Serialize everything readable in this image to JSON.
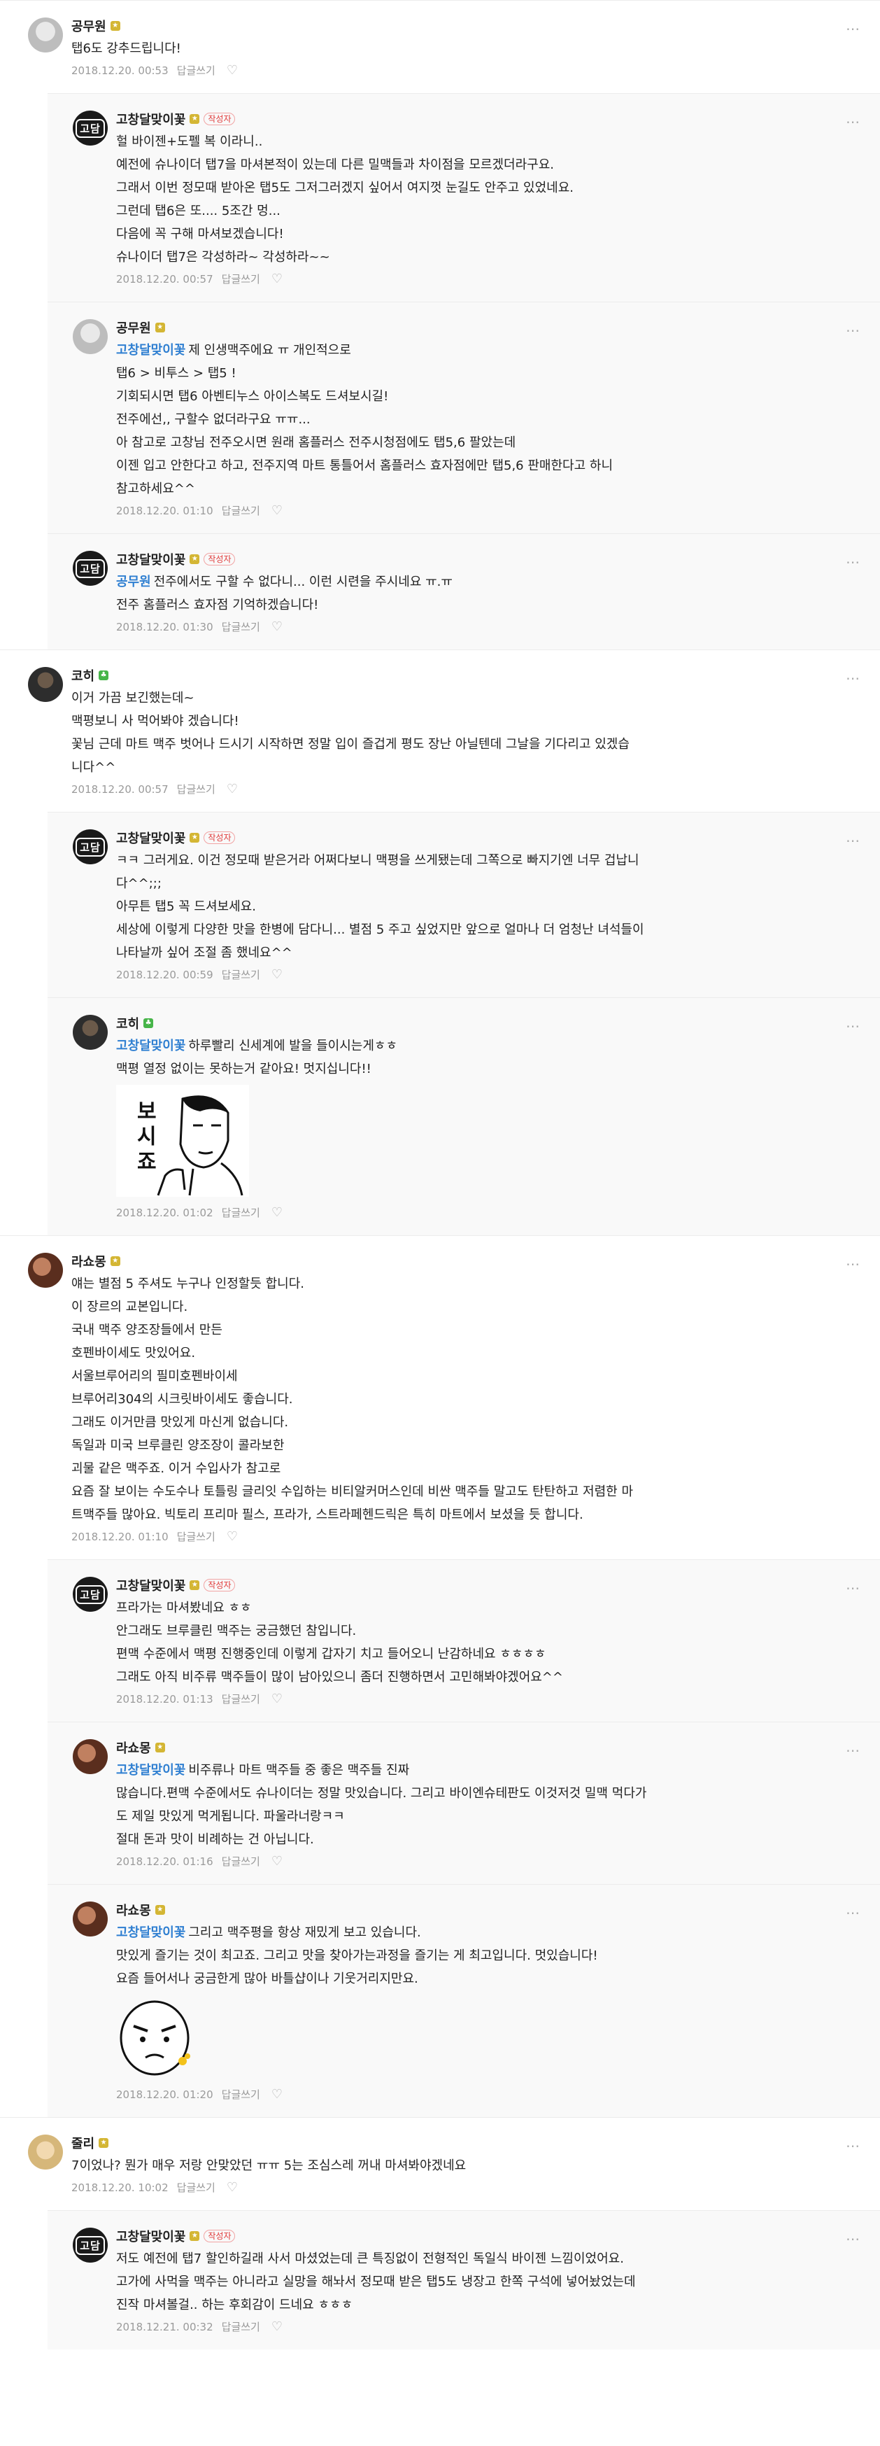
{
  "comments": [
    {
      "id": "c1",
      "reply": false,
      "name": "공무원",
      "avatar": "p1",
      "badge": "gold",
      "author_tag": "",
      "mention": "",
      "text": "탭6도 강추드립니다!",
      "date": "2018.12.20. 00:53",
      "reply_label": "답글쓰기",
      "sticker": ""
    },
    {
      "id": "c2",
      "reply": true,
      "name": "고창달맞이꽃",
      "avatar": "brand",
      "badge": "gold",
      "author_tag": "작성자",
      "mention": "",
      "text": "헐 바이젠+도펠 복 이라니..\n예전에 슈나이더 탭7을 마셔본적이 있는데 다른 밀맥들과 차이점을 모르겠더라구요.\n그래서 이번 정모때 받아온 탭5도 그저그러겠지 싶어서 여지껏 눈길도 안주고 있었네요.\n그런데 탭6은 또.... 5조간 멍...\n다음에 꼭 구해 마셔보겠습니다!\n슈나이더 탭7은 각성하라~ 각성하라~~",
      "date": "2018.12.20. 00:57",
      "reply_label": "답글쓰기",
      "sticker": ""
    },
    {
      "id": "c3",
      "reply": true,
      "name": "공무원",
      "avatar": "p1",
      "badge": "gold",
      "author_tag": "",
      "mention": "고창달맞이꽃",
      "text": "제 인생맥주에요 ㅠ 개인적으로\n탭6 > 비투스 > 탭5 !\n기회되시면 탭6 아벤티누스 아이스복도 드셔보시길!\n전주에선,, 구할수 없더라구요 ㅠㅠ...\n아 참고로 고창님 전주오시면 원래 홈플러스 전주시청점에도 탭5,6 팔았는데\n이젠 입고 안한다고 하고, 전주지역 마트 통틀어서 홈플러스 효자점에만 탭5,6 판매한다고 하니\n참고하세요^^",
      "date": "2018.12.20. 01:10",
      "reply_label": "답글쓰기",
      "sticker": ""
    },
    {
      "id": "c4",
      "reply": true,
      "name": "고창달맞이꽃",
      "avatar": "brand",
      "badge": "gold",
      "author_tag": "작성자",
      "mention": "공무원",
      "text": "전주에서도 구할 수 없다니... 이런 시련을 주시네요 ㅠ.ㅠ\n전주 홈플러스 효자점 기억하겠습니다!",
      "date": "2018.12.20. 01:30",
      "reply_label": "답글쓰기",
      "sticker": ""
    },
    {
      "id": "c5",
      "reply": false,
      "name": "코히",
      "avatar": "p2",
      "badge": "green",
      "author_tag": "",
      "mention": "",
      "text": "이거 가끔 보긴했는데~\n맥평보니 사 먹어봐야 겠습니다!\n꽃님 근데 마트 맥주 벗어나 드시기 시작하면 정말 입이 즐겁게 평도 장난 아닐텐데 그날을 기다리고 있겠습\n니다^^",
      "date": "2018.12.20. 00:57",
      "reply_label": "답글쓰기",
      "sticker": ""
    },
    {
      "id": "c6",
      "reply": true,
      "name": "고창달맞이꽃",
      "avatar": "brand",
      "badge": "gold",
      "author_tag": "작성자",
      "mention": "",
      "text": "ㅋㅋ 그러게요. 이건 정모때 받은거라 어쩌다보니 맥평을 쓰게됐는데 그쪽으로 빠지기엔 너무 겁납니\n다^^;;;\n아무튼 탭5 꼭 드셔보세요.\n세상에 이렇게 다양한 맛을 한병에 담다니... 별점 5 주고 싶었지만 앞으로 얼마나 더 엄청난 녀석들이\n나타날까 싶어 조절 좀 했네요^^",
      "date": "2018.12.20. 00:59",
      "reply_label": "답글쓰기",
      "sticker": ""
    },
    {
      "id": "c7",
      "reply": true,
      "name": "코히",
      "avatar": "p2",
      "badge": "green",
      "author_tag": "",
      "mention": "고창달맞이꽃",
      "text": "하루빨리 신세계에 발을 들이시는게ㅎㅎ\n맥평 열정 없이는 못하는거 같아요! 멋지십니다!!",
      "date": "2018.12.20. 01:02",
      "reply_label": "답글쓰기",
      "sticker": "bosijyo",
      "sticker_text": "보시죠"
    },
    {
      "id": "c8",
      "reply": false,
      "name": "라쇼몽",
      "avatar": "p3",
      "badge": "gold",
      "author_tag": "",
      "mention": "",
      "text": "얘는 별점 5 주셔도 누구나 인정할듯 합니다.\n이 장르의 교본입니다.\n국내 맥주 양조장들에서 만든\n호펜바이세도 맛있어요.\n서울브루어리의 필미호펜바이세\n브루어리304의 시크릿바이세도 좋습니다.\n그래도 이거만큼 맛있게 마신게 없습니다.\n독일과 미국 브루클린 양조장이 콜라보한\n괴물 같은 맥주죠. 이거 수입사가 참고로\n요즘 잘 보이는 수도수나 토틀링 글리잇 수입하는 비티알커머스인데 비싼 맥주들 말고도 탄탄하고 저렴한 마\n트맥주들 많아요. 빅토리 프리마 필스, 프라가, 스트라페헨드릭은 특히 마트에서 보셨을 듯 합니다.",
      "date": "2018.12.20. 01:10",
      "reply_label": "답글쓰기",
      "sticker": ""
    },
    {
      "id": "c9",
      "reply": true,
      "name": "고창달맞이꽃",
      "avatar": "brand",
      "badge": "gold",
      "author_tag": "작성자",
      "mention": "",
      "text": "프라가는 마셔봤네요 ㅎㅎ\n안그래도 브루클린 맥주는 궁금했던 참입니다.\n편맥 수준에서 맥평 진행중인데 이렇게 갑자기 치고 들어오니 난감하네요 ㅎㅎㅎㅎ\n그래도 아직 비주류 맥주들이 많이 남아있으니 좀더 진행하면서 고민해봐야겠어요^^",
      "date": "2018.12.20. 01:13",
      "reply_label": "답글쓰기",
      "sticker": ""
    },
    {
      "id": "c10",
      "reply": true,
      "name": "라쇼몽",
      "avatar": "p3",
      "badge": "gold",
      "author_tag": "",
      "mention": "고창달맞이꽃",
      "text": "비주류나 마트 맥주들 중 좋은 맥주들 진짜\n많습니다.편맥 수준에서도 슈나이더는 정말 맛있습니다. 그리고 바이엔슈테판도 이것저것 밀맥 먹다가\n도 제일 맛있게 먹게됩니다. 파울라너랑ㅋㅋ\n절대 돈과 맛이 비례하는 건 아닙니다.",
      "date": "2018.12.20. 01:16",
      "reply_label": "답글쓰기",
      "sticker": ""
    },
    {
      "id": "c11",
      "reply": true,
      "name": "라쇼몽",
      "avatar": "p3",
      "badge": "gold",
      "author_tag": "",
      "mention": "고창달맞이꽃",
      "text": "그리고 맥주평을 항상 재밌게 보고 있습니다.\n맛있게 즐기는 것이 최고죠. 그리고 맛을 찾아가는과정을 즐기는 게 최고입니다. 멋있습니다!\n요즘 들어서나 궁금한게 많아 바틀샵이나 기웃거리지만요.",
      "date": "2018.12.20. 01:20",
      "reply_label": "답글쓰기",
      "sticker": "face"
    },
    {
      "id": "c12",
      "reply": false,
      "name": "줄리",
      "avatar": "p4",
      "badge": "gold",
      "author_tag": "",
      "mention": "",
      "text": "7이었나? 뭔가 매우 저랑 안맞았던 ㅠㅠ 5는 조심스레 꺼내 마셔봐야겠네요",
      "date": "2018.12.20. 10:02",
      "reply_label": "답글쓰기",
      "sticker": ""
    },
    {
      "id": "c13",
      "reply": true,
      "name": "고창달맞이꽃",
      "avatar": "brand",
      "badge": "gold",
      "author_tag": "작성자",
      "mention": "",
      "text": "저도 예전에 탭7 할인하길래 사서 마셨었는데 큰 특징없이 전형적인 독일식 바이젠 느낌이었어요.\n고가에 사먹을 맥주는 아니라고 실망을 해놔서 정모때 받은 탭5도 냉장고 한쪽 구석에 넣어놨었는데\n진작 마셔볼걸.. 하는 후회감이 드네요 ㅎㅎㅎ",
      "date": "2018.12.21. 00:32",
      "reply_label": "답글쓰기",
      "sticker": ""
    }
  ],
  "brand_avatar_text": "고담",
  "more_icon": "⋯",
  "heart_icon": "♡"
}
